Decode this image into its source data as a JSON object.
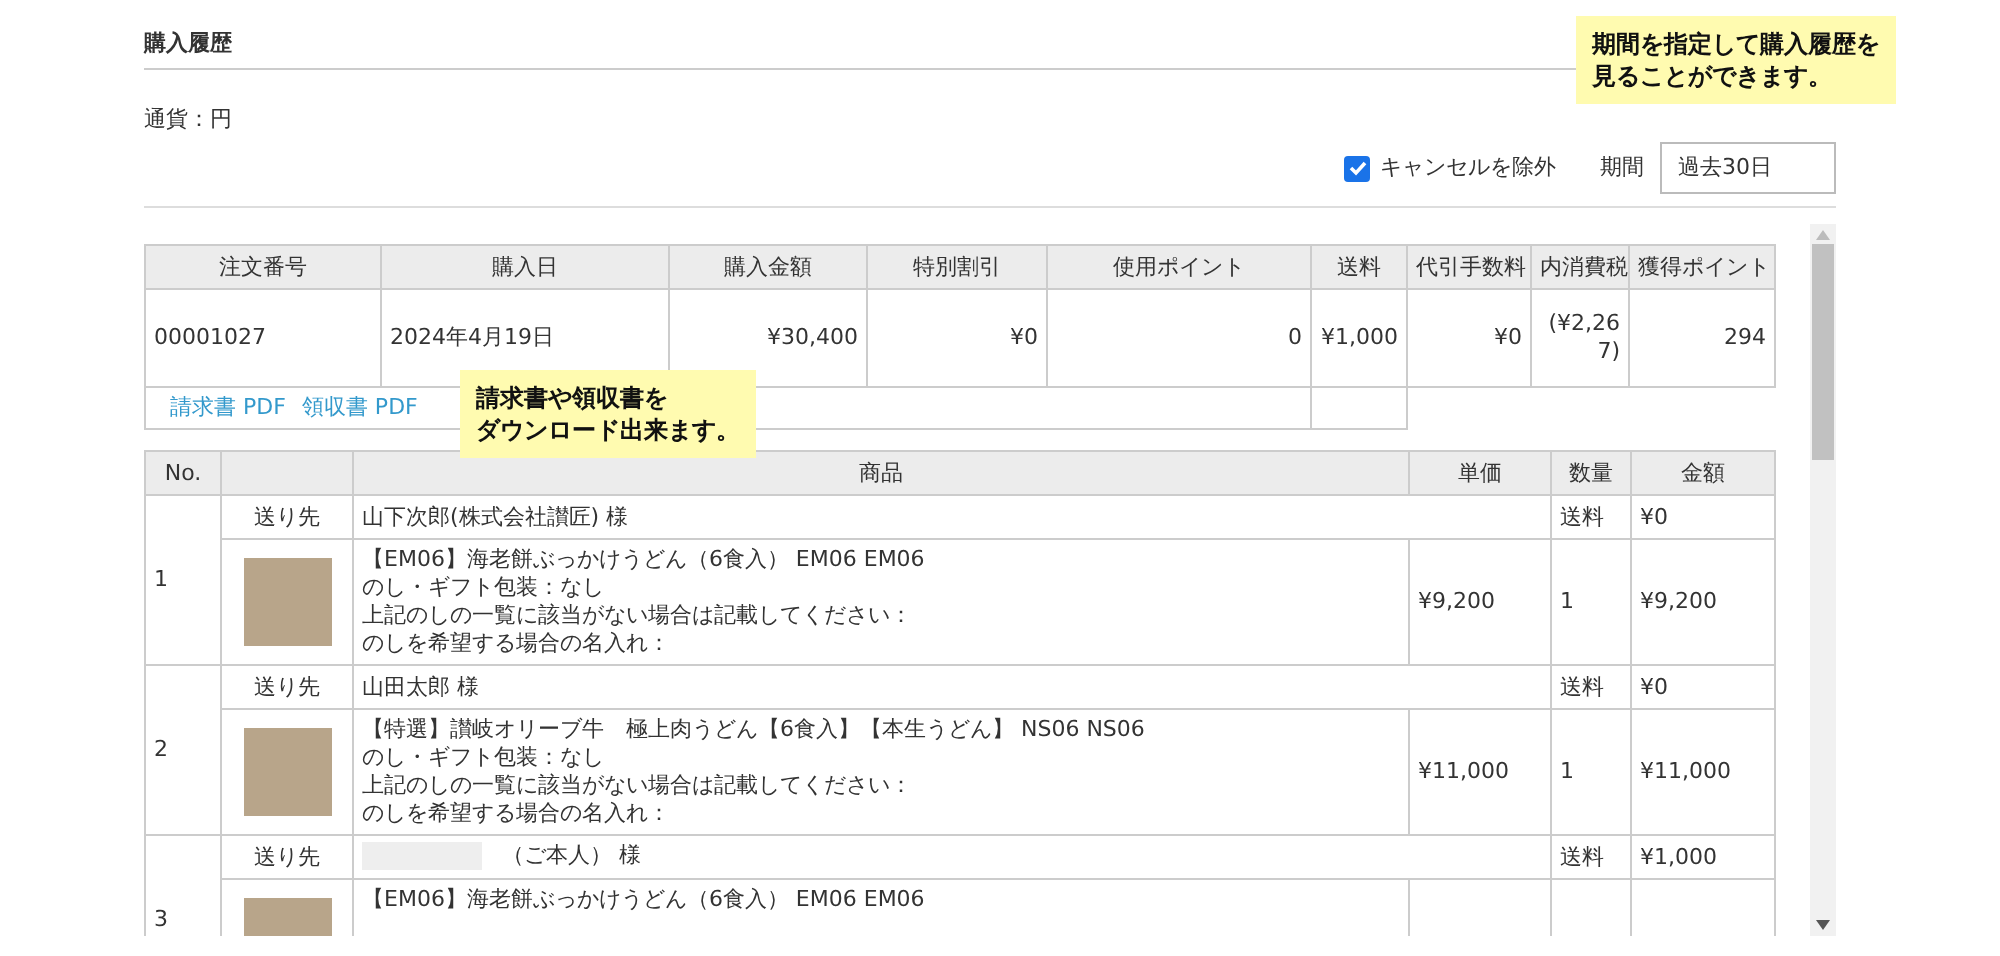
{
  "title": "購入履歴",
  "currency": "通貨：円",
  "filter": {
    "exclude_cancel": {
      "label": "キャンセルを除外",
      "checked": true
    },
    "period": {
      "label": "期間",
      "value": "過去30日"
    }
  },
  "notes": [
    {
      "lines": [
        "期間を指定して購入履歴を",
        "見ることができます。"
      ],
      "kind": "top"
    },
    {
      "lines": [
        "請求書や領収書を",
        "ダウンロード出来ます。"
      ],
      "kind": "links"
    }
  ],
  "order_table": {
    "columns": [
      "注文番号",
      "購入日",
      "購入金額",
      "特別割引",
      "使用ポイント",
      "送料",
      "代引手数料",
      "内消費税",
      "獲得ポイント"
    ],
    "row": [
      "00001027",
      "2024年4月19日",
      "¥30,400",
      "¥0",
      "0",
      "¥1,000",
      "¥0",
      "(¥2,267)",
      "294"
    ],
    "links": [
      "請求書 PDF",
      "領収書 PDF"
    ]
  },
  "items_table": {
    "columns": [
      "No.",
      "商品",
      "単価",
      "数量",
      "金額"
    ]
  },
  "items": [
    {
      "no": "1",
      "ship_label": "送り先",
      "recipient": "山下次郎(株式会社讃匠) 様",
      "redacted": false,
      "shipping_label": "送料",
      "shipping": "¥0",
      "product_lines": [
        "【EM06】海老餅ぶっかけうどん（6食入） EM06 EM06",
        "のし・ギフト包装：なし",
        "上記のしの一覧に該当がない場合は記載してください：",
        "のしを希望する場合の名入れ："
      ],
      "unit_price": "¥9,200",
      "quantity": "1",
      "amount": "¥9,200"
    },
    {
      "no": "2",
      "ship_label": "送り先",
      "recipient": "山田太郎 様",
      "redacted": false,
      "shipping_label": "送料",
      "shipping": "¥0",
      "product_lines": [
        "【特選】讃岐オリーブ牛　極上肉うどん【6食入】【本生うどん】 NS06 NS06",
        "のし・ギフト包装：なし",
        "上記のしの一覧に該当がない場合は記載してください：",
        "のしを希望する場合の名入れ："
      ],
      "unit_price": "¥11,000",
      "quantity": "1",
      "amount": "¥11,000"
    },
    {
      "no": "3",
      "ship_label": "送り先",
      "recipient": "（ご本人） 様",
      "redacted": true,
      "shipping_label": "送料",
      "shipping": "¥1,000",
      "product_lines": [
        "【EM06】海老餅ぶっかけうどん（6食入） EM06 EM06"
      ]
    }
  ]
}
